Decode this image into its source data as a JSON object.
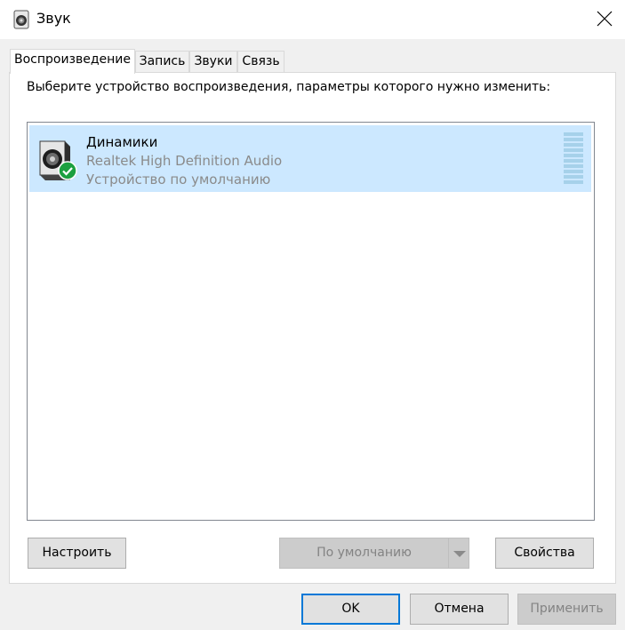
{
  "window": {
    "title": "Звук",
    "close_icon": "close-icon",
    "title_icon": "speaker-icon"
  },
  "tabs": [
    {
      "label": "Воспроизведение",
      "active": true
    },
    {
      "label": "Запись",
      "active": false
    },
    {
      "label": "Звуки",
      "active": false
    },
    {
      "label": "Связь",
      "active": false
    }
  ],
  "playback": {
    "instruction": "Выберите устройство воспроизведения, параметры которого нужно изменить:",
    "devices": [
      {
        "name": "Динамики",
        "driver": "Realtek High Definition Audio",
        "status": "Устройство по умолчанию",
        "selected": true,
        "is_default": true,
        "icon": "speaker-icon",
        "badge_icon": "default-check-icon"
      }
    ],
    "buttons": {
      "configure": "Настроить",
      "set_default": "По умолчанию",
      "properties": "Свойства"
    }
  },
  "dialog_buttons": {
    "ok": "OK",
    "cancel": "Отмена",
    "apply": "Применить"
  },
  "colors": {
    "selection": "#cce8ff",
    "default_border": "#0078d7",
    "check_badge": "#1ca040"
  }
}
